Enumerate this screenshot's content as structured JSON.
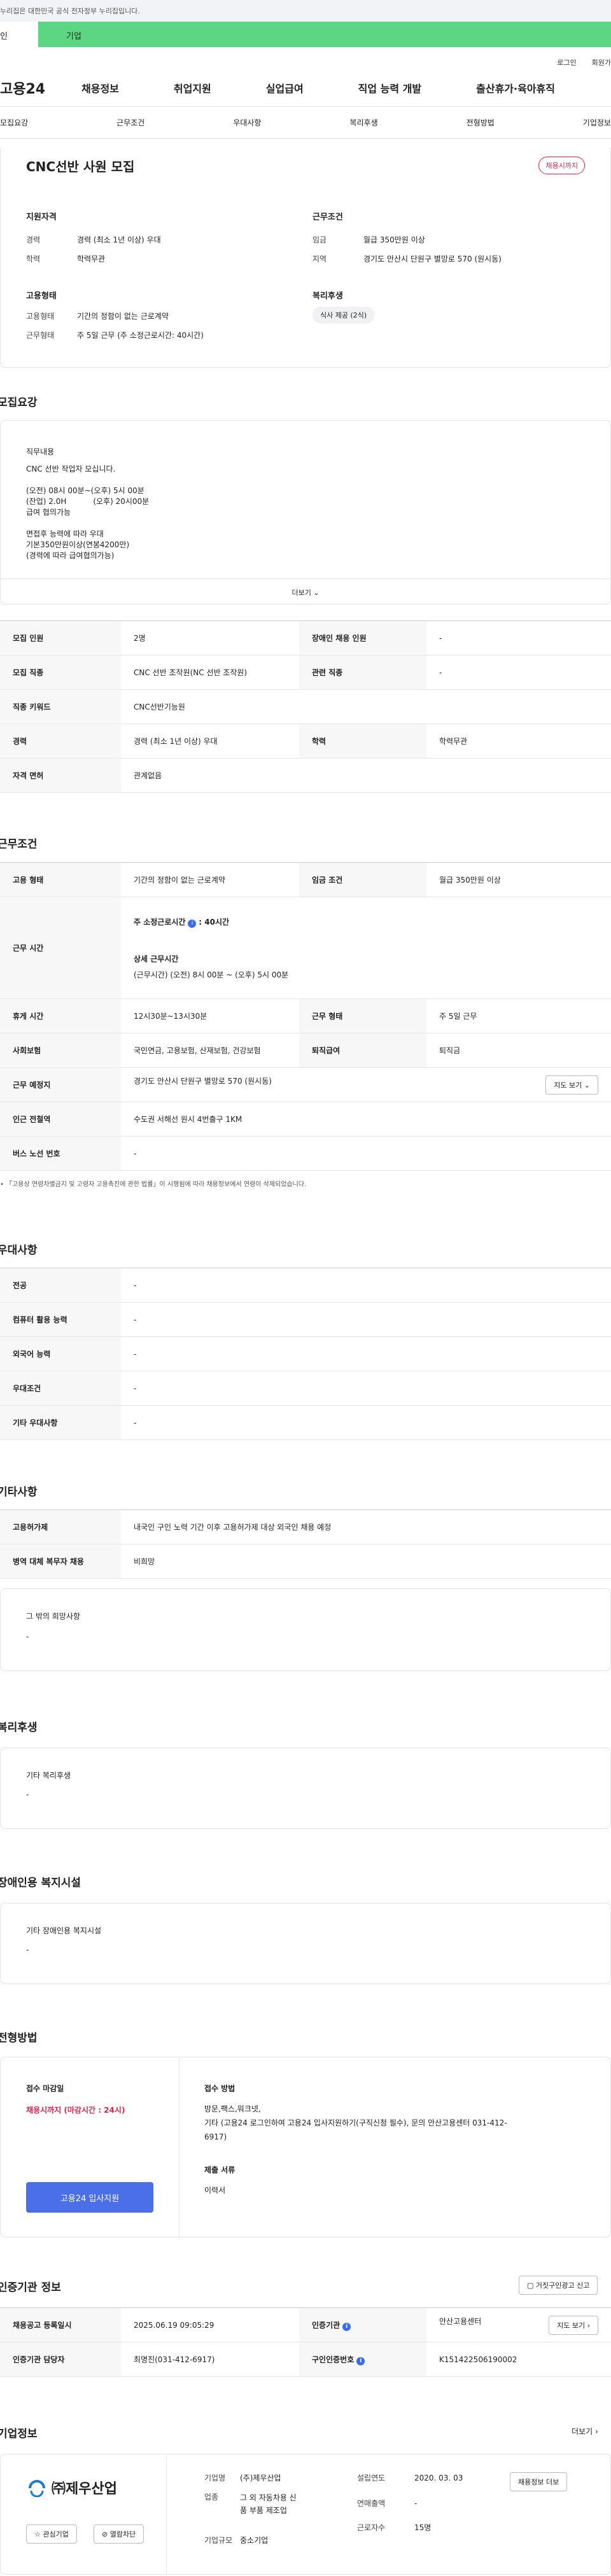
{
  "gov_notice": "누리집은 대한민국 공식 전자정부 누리집입니다.",
  "user_tabs": [
    "인",
    "기업"
  ],
  "top_links": [
    "로그인",
    "회원가"
  ],
  "logo": "고용24",
  "gnb": [
    "채용정보",
    "취업지원",
    "실업급여",
    "직업 능력 개발",
    "출산휴가·육아휴직"
  ],
  "snb": [
    "모집요강",
    "근무조건",
    "우대사항",
    "복리후생",
    "전형방법",
    "기업정보"
  ],
  "summary": {
    "title": "CNC선반 사원 모집",
    "status": "채용시까지",
    "qual_title": "지원자격",
    "qual": [
      {
        "k": "경력",
        "v": "경력 (최소 1년 이상) 우대"
      },
      {
        "k": "학력",
        "v": "학력무관"
      }
    ],
    "cond_title": "근무조건",
    "cond": [
      {
        "k": "임금",
        "v": "월급 350만원 이상"
      },
      {
        "k": "지역",
        "v": "경기도 안산시 단원구 별망로 570 (원시동)"
      }
    ],
    "emp_title": "고용형태",
    "emp": [
      {
        "k": "고용형태",
        "v": "기간의 정함이 없는 근로계약"
      },
      {
        "k": "근무형태",
        "v": "주 5일 근무 (주 소정근로시간: 40시간)"
      }
    ],
    "welfare_title": "복리후생",
    "welfare_chip": "식사 제공 (2식)"
  },
  "recruit": {
    "title": "모집요강",
    "job_label": "직무내용",
    "job_lines": [
      "CNC 선반 작업자 모십니다.",
      "",
      "(오전) 08시 00분~(오후) 5시 00분",
      "(잔업) 2.0H           (오후) 20시00분",
      "급여 협의가능",
      "",
      "면접후 능력에 따라 우대",
      "기본350만원이상(연봉4200만)",
      "(경력에 따라 급여협의가능)"
    ],
    "more": "더보기",
    "rows": [
      [
        {
          "h": "모집 인원"
        },
        {
          "v": "2명"
        },
        {
          "h": "장애인 채용 인원"
        },
        {
          "v": "-"
        }
      ],
      [
        {
          "h": "모집 직종"
        },
        {
          "v": "CNC 선반 조작원(NC 선반 조작원)"
        },
        {
          "h": "관련 직종"
        },
        {
          "v": "-"
        }
      ],
      [
        {
          "h": "직종 키워드"
        },
        {
          "v": "CNC선반기능원"
        }
      ],
      [
        {
          "h": "경력"
        },
        {
          "v": "경력 (최소 1년 이상) 우대"
        },
        {
          "h": "학력"
        },
        {
          "v": "학력무관"
        }
      ],
      [
        {
          "h": "자격 면허"
        },
        {
          "v": "관계없음"
        }
      ]
    ]
  },
  "work": {
    "title": "근무조건",
    "emp_type_h": "고용 형태",
    "emp_type_v": "기간의 정함이 없는 근로계약",
    "wage_h": "임금 조건",
    "wage_v": "월급 350만원 이상",
    "hours_h": "근무 시간",
    "hours_weekly": "주 소정근로시간",
    "hours_weekly_v": ": 40시간",
    "hours_detail_t": "상세 근무시간",
    "hours_detail_v": "(근무시간) (오전) 8시 00분 ~ (오후) 5시 00분",
    "rest_h": "휴게 시간",
    "rest_v": "12시30분~13시30분",
    "form_h": "근무 형태",
    "form_v": "주 5일 근무",
    "ins_h": "사회보험",
    "ins_v": "국민연금, 고용보험, 산재보험, 건강보험",
    "sev_h": "퇴직급여",
    "sev_v": "퇴직금",
    "loc_h": "근무 예정지",
    "loc_v": "경기도 안산시 단원구 별망로 570 (원시동)",
    "map_btn": "지도 보기",
    "sub_h": "인근 전철역",
    "sub_v": "수도권 서해선 원시 4번출구 1KM",
    "bus_h": "버스 노선 번호",
    "bus_v": "-",
    "note": "「고용상 연령차별금지 및 고령자 고용촉진에 관한 법률」이 시행됨에 따라 채용정보에서 연령이 삭제되었습니다."
  },
  "pref": {
    "title": "우대사항",
    "rows": [
      {
        "h": "전공",
        "v": "-"
      },
      {
        "h": "컴퓨터 활용 능력",
        "v": "-"
      },
      {
        "h": "외국어 능력",
        "v": "-"
      },
      {
        "h": "우대조건",
        "v": "-"
      },
      {
        "h": "기타 우대사항",
        "v": "-"
      }
    ]
  },
  "etc": {
    "title": "기타사항",
    "rows": [
      {
        "h": "고용허가제",
        "v": "내국인 구인 노력 기간 이후 고용허가제 대상 외국인 채용 예정"
      },
      {
        "h": "병역 대체 복무자 채용",
        "v": "비희망"
      }
    ],
    "box_t": "그 밖의 희망사항",
    "box_v": "-"
  },
  "benefit": {
    "title": "복리후생",
    "box_t": "기타 복리후생",
    "box_v": "-"
  },
  "disab": {
    "title": "장애인용 복지시설",
    "box_t": "기타 장애인용 복지시설",
    "box_v": "-"
  },
  "screen": {
    "title": "전형방법",
    "deadline_t": "접수 마감일",
    "deadline_v": "채용시까지 (마감시간 : 24시)",
    "apply_btn": "고용24 입사지원",
    "method_t": "접수 방법",
    "method_v": [
      "방문,팩스,워크넷,",
      "기타 (고용24 로그인하여 고용24 입사지원하기(구직신청 필수), 문의 안산고용센터 031-412-",
      "6917)"
    ],
    "docs_t": "제출 서류",
    "docs_v": "이력서"
  },
  "cert": {
    "title": "인증기관 정보",
    "report_btn": "거짓구인광고 신고",
    "reg_h": "채용공고 등록일시",
    "reg_v": "2025.06.19 09:05:29",
    "org_h": "인증기관",
    "org_v": "안산고용센터",
    "map_btn": "지도 보기",
    "mgr_h": "인증기관 담당자",
    "mgr_v": "최명진(031-412-6917)",
    "no_h": "구인인증번호",
    "no_v": "K151422506190002"
  },
  "company": {
    "title": "기업정보",
    "more": "더보기",
    "logo_text": "㈜제우산업",
    "fav": "관심기업",
    "block": "열람차단",
    "f": [
      {
        "k": "기업명",
        "v": "(주)제우산업"
      },
      {
        "k": "업종",
        "v": "그 외 자동차용 신",
        "v2": "품 부품 제조업"
      },
      {
        "k": "기업규모",
        "v": "중소기업"
      }
    ],
    "f2": [
      {
        "k": "설립연도",
        "v": "2020. 03. 03"
      },
      {
        "k": "연매출액",
        "v": "-"
      },
      {
        "k": "근로자수",
        "v": "15명"
      }
    ],
    "job_btn": "채용정보 더보"
  }
}
